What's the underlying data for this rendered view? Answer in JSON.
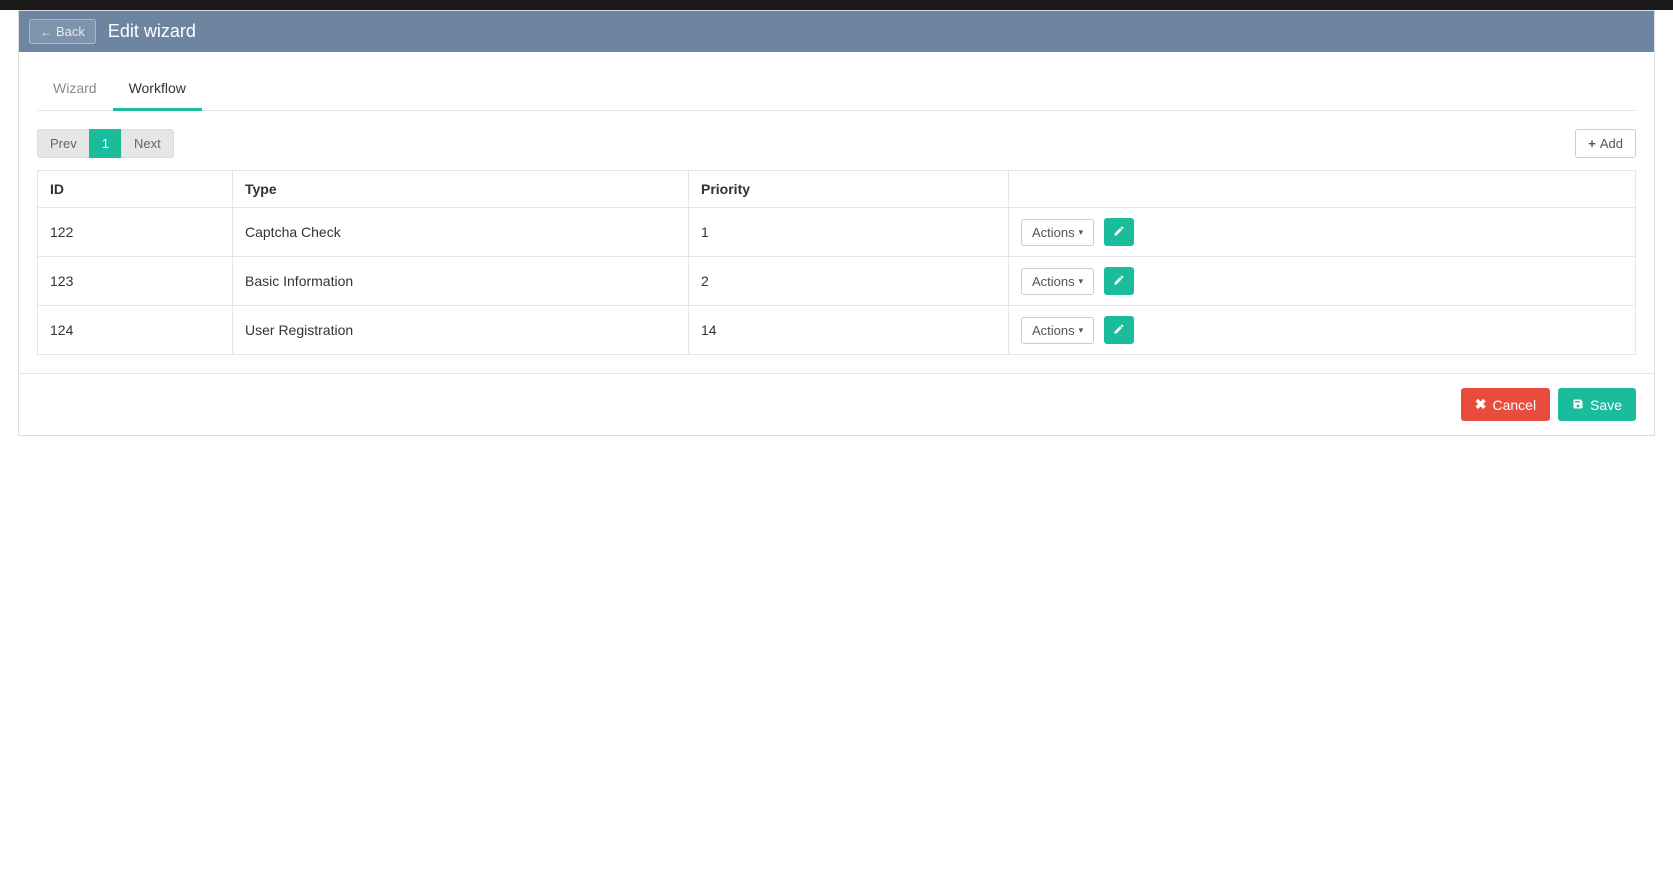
{
  "header": {
    "back_label": "Back",
    "title": "Edit wizard"
  },
  "tabs": [
    {
      "label": "Wizard",
      "active": false
    },
    {
      "label": "Workflow",
      "active": true
    }
  ],
  "pager": {
    "prev": "Prev",
    "next": "Next",
    "pages": [
      "1"
    ],
    "active_index": 0
  },
  "toolbar": {
    "add_label": "Add"
  },
  "table": {
    "columns": [
      "ID",
      "Type",
      "Priority",
      ""
    ],
    "actions_label": "Actions",
    "rows": [
      {
        "id": "122",
        "type": "Captcha Check",
        "priority": "1"
      },
      {
        "id": "123",
        "type": "Basic Information",
        "priority": "2"
      },
      {
        "id": "124",
        "type": "User Registration",
        "priority": "14"
      }
    ]
  },
  "footer": {
    "cancel_label": "Cancel",
    "save_label": "Save"
  }
}
